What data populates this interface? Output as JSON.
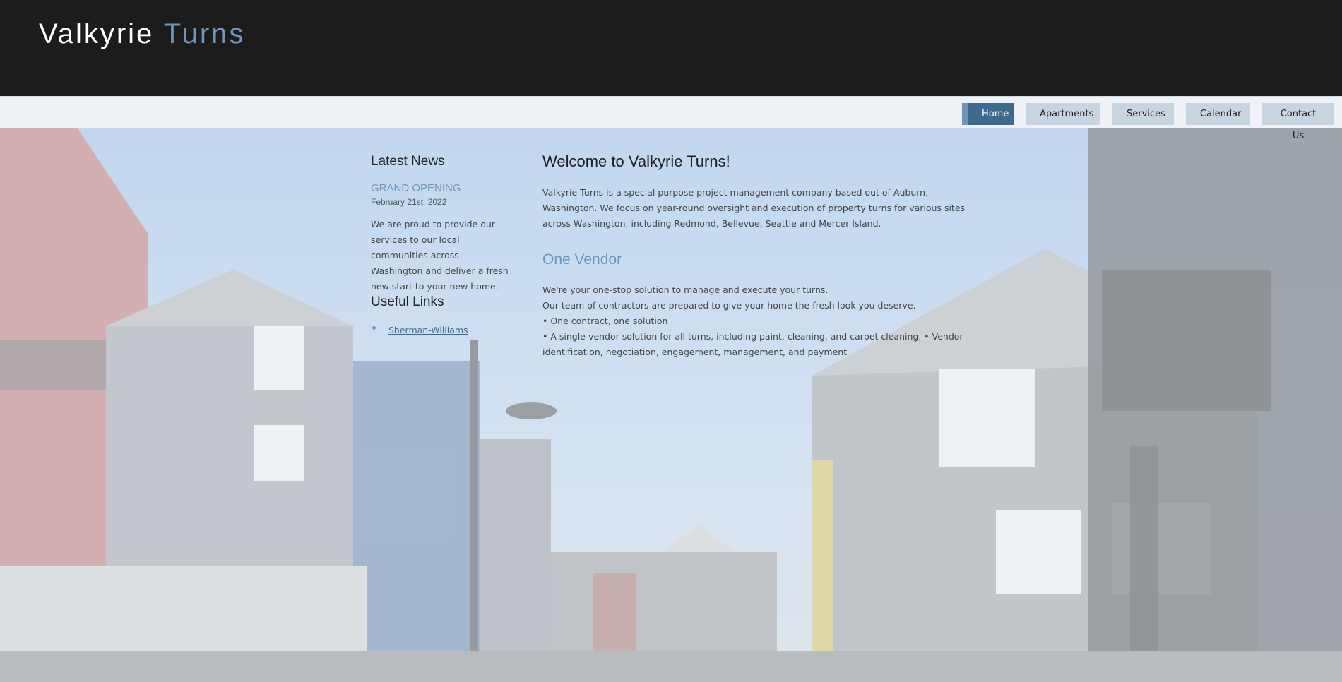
{
  "header": {
    "logo_main": "Valkyrie",
    "logo_accent": "Turns"
  },
  "nav": {
    "items": [
      {
        "label": "Home",
        "active": true
      },
      {
        "label": "Apartments",
        "active": false
      },
      {
        "label": "Services",
        "active": false
      },
      {
        "label": "Calendar",
        "active": false
      },
      {
        "label": "Contact Us",
        "active": false
      }
    ]
  },
  "sidebar": {
    "news_heading": "Latest News",
    "news_title": "GRAND OPENING",
    "news_date": "February 21st, 2022",
    "news_body": "We are proud to provide our services to our local communities across Washington and deliver a fresh new start to your new home.",
    "links_heading": "Useful Links",
    "links": [
      {
        "label": "Sherman-Williams"
      }
    ]
  },
  "main": {
    "welcome_heading": "Welcome to Valkyrie Turns!",
    "intro": "Valkyrie Turns is a special purpose project management company based out of Auburn, Washington. We focus on year-round oversight and execution of property turns for various sites across Washington, including Redmond, Bellevue, Seattle and Mercer Island.",
    "vendor_heading": "One Vendor",
    "vendor_lines": [
      "We're your one-stop solution to manage and execute your turns.",
      "Our team of contractors are prepared to give your home the fresh look you deserve.",
      "• One contract, one solution",
      "• A single-vendor solution for all turns, including paint, cleaning, and carpet cleaning. • Vendor identification, negotiation, engagement, management, and payment"
    ]
  },
  "colors": {
    "header_bg": "#1c1c1c",
    "accent": "#6f95bd",
    "nav_active": "#3e6a8e",
    "nav_button": "#c7d5e0"
  }
}
